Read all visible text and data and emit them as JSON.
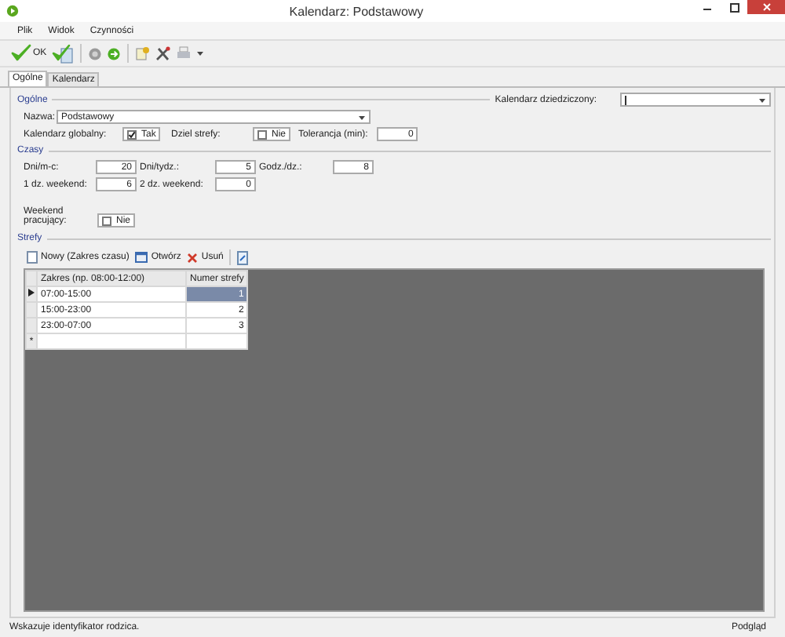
{
  "window": {
    "title": "Kalendarz: Podstawowy"
  },
  "menu": [
    "Plik",
    "Widok",
    "Czynności"
  ],
  "toolbar": {
    "ok_label": "OK"
  },
  "tabs": [
    {
      "label": "Ogólne",
      "selected": true
    },
    {
      "label": "Kalendarz",
      "selected": false
    }
  ],
  "general": {
    "section": "Ogólne",
    "inherited_label": "Kalendarz dziedziczony:",
    "name_label": "Nazwa:",
    "name_value": "Podstawowy",
    "global_label": "Kalendarz globalny:",
    "global": {
      "checked": true,
      "text": "Tak"
    },
    "split_label": "Dziel strefy:",
    "split": {
      "checked": false,
      "text": "Nie"
    },
    "tolerance_label": "Tolerancja (min):",
    "tolerance_value": "0"
  },
  "times": {
    "section": "Czasy",
    "fields": [
      {
        "label": "Dni/m-c:",
        "value": "20"
      },
      {
        "label": "Dni/tydz.:",
        "value": "5"
      },
      {
        "label": "Godz./dz.:",
        "value": "8"
      },
      {
        "label": "1 dz. weekend:",
        "value": "6"
      },
      {
        "label": "2 dz. weekend:",
        "value": "0"
      }
    ],
    "weekend_label": "Weekend pracujący:",
    "weekend": {
      "checked": false,
      "text": "Nie"
    }
  },
  "zones": {
    "section": "Strefy",
    "actions": [
      {
        "kind": "new",
        "label": "Nowy (Zakres czasu)"
      },
      {
        "kind": "open",
        "label": "Otwórz"
      },
      {
        "kind": "delete",
        "label": "Usuń"
      },
      {
        "kind": "export"
      }
    ],
    "columns": [
      "Zakres (np. 08:00-12:00)",
      "Numer strefy"
    ],
    "rows": [
      {
        "range": "07:00-15:00",
        "number": "1",
        "selected": true
      },
      {
        "range": "15:00-23:00",
        "number": "2",
        "selected": false
      },
      {
        "range": "23:00-07:00",
        "number": "3",
        "selected": false
      }
    ],
    "new_row_mark": "*"
  },
  "status_bar": {
    "message": "Wskazuje identyfikator rodzica.",
    "mode": "Podgląd"
  }
}
